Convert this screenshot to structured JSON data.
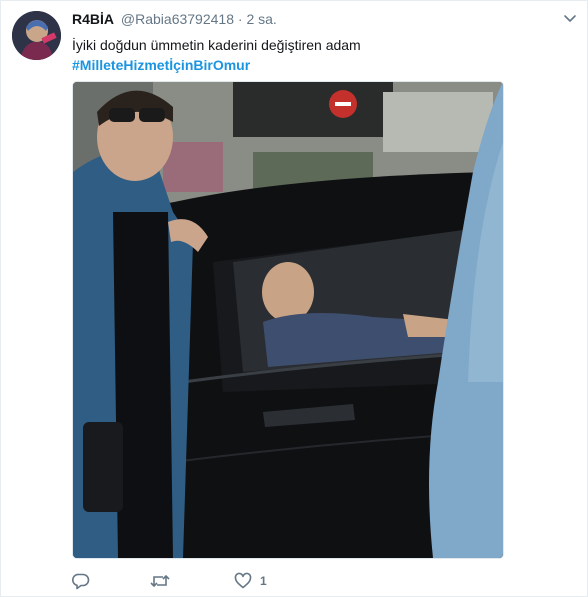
{
  "tweet": {
    "display_name": "R4BİA",
    "handle": "@Rabia63792418",
    "separator": "·",
    "time": "2 sa.",
    "text": "İyiki doğdun ümmetin kaderini değiştiren adam",
    "hashtag": "#MilleteHizmetİçinBirOmur",
    "like_count": "1"
  },
  "icons": {
    "menu": "chevron-down-icon",
    "reply": "reply-icon",
    "retweet": "retweet-icon",
    "like": "heart-icon"
  },
  "colors": {
    "link": "#1b95e0",
    "secondary_text": "#657786",
    "border": "#e6ecf0"
  }
}
